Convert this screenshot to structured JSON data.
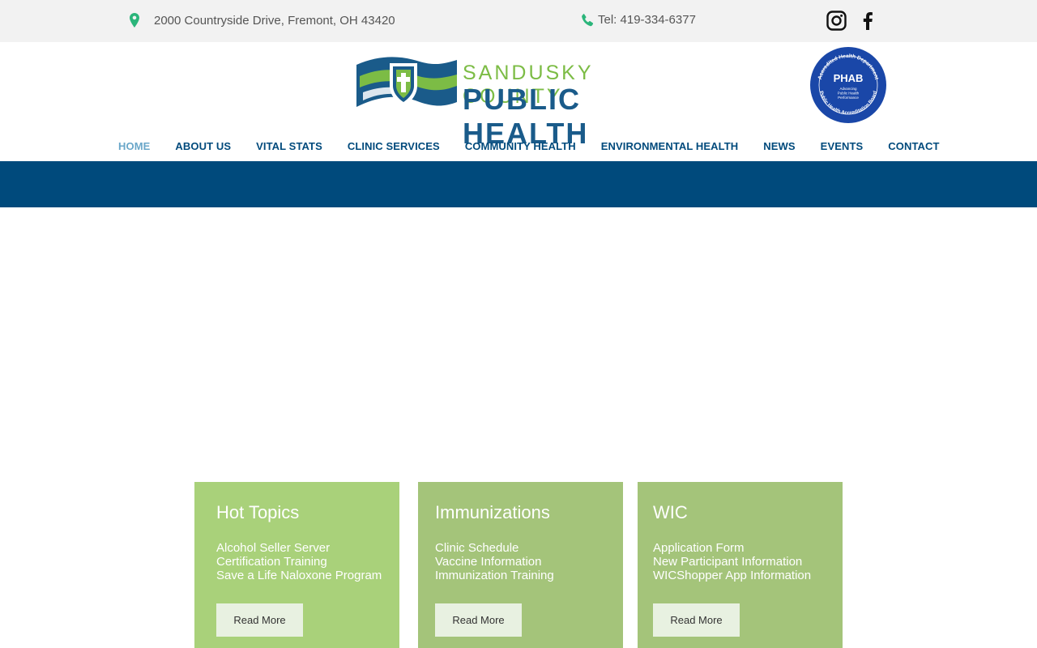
{
  "topbar": {
    "address": "2000 Countryside Drive, Fremont, OH 43420",
    "phone": "Tel: 419-334-6377"
  },
  "logo": {
    "line1": "SANDUSKY COUNTY",
    "line2": "PUBLIC HEALTH"
  },
  "seal": {
    "center": "PHAB",
    "sub": [
      "Advancing",
      "Public Health",
      "Performance"
    ],
    "ring_top": "Accredited Health Department",
    "ring_bottom": "Public Health Accreditation Board"
  },
  "nav": [
    {
      "label": "HOME"
    },
    {
      "label": "ABOUT US"
    },
    {
      "label": "VITAL STATS"
    },
    {
      "label": "CLINIC SERVICES"
    },
    {
      "label": "COMMUNITY HEALTH"
    },
    {
      "label": "ENVIRONMENTAL HEALTH"
    },
    {
      "label": "NEWS"
    },
    {
      "label": "EVENTS"
    },
    {
      "label": "CONTACT"
    }
  ],
  "cards": [
    {
      "title": "Hot Topics",
      "lines": [
        "Alcohol Seller Server",
        "Certification Training",
        "Save a Life Naloxone Program"
      ],
      "button": "Read More"
    },
    {
      "title": "Immunizations",
      "lines": [
        "Clinic Schedule",
        "Vaccine Information",
        "Immunization Training"
      ],
      "button": "Read More"
    },
    {
      "title": "WIC",
      "lines": [
        "Application Form",
        "New Participant Information",
        "WICShopper App Information"
      ],
      "button": "Read More"
    }
  ],
  "colors": {
    "nav": "#004a7c",
    "nav_active": "#6aa7c9",
    "banner": "#004a7c",
    "card_green": "#a4c47a",
    "accent_green": "#7cbc45"
  }
}
